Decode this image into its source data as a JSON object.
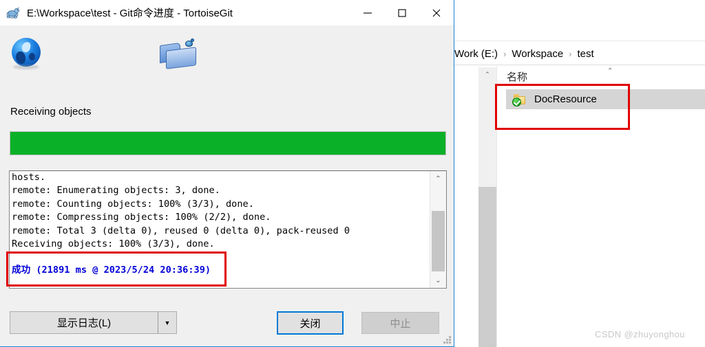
{
  "explorer": {
    "breadcrumb": {
      "items": [
        "Work (E:)",
        "Workspace",
        "test"
      ],
      "separator": "›"
    },
    "column_header": {
      "name_label": "名称",
      "sort_chevron": "⌃"
    },
    "items": [
      {
        "name": "DocResource",
        "icon": "folder-with-green-check-icon",
        "selected": true
      }
    ],
    "scrollbar": {
      "up_chevron": "⌃"
    }
  },
  "watermark": "CSDN @zhuyonghou",
  "dialog": {
    "title": "E:\\Workspace\\test - Git命令进度 - TortoiseGit",
    "icon": "tortoisegit-turtle-icon",
    "window_controls": {
      "minimize": "—",
      "maximize": "□",
      "close": "✕"
    },
    "status_label": "Receiving objects",
    "progress": {
      "percent": 100,
      "fill_color": "#0ab027"
    },
    "console": {
      "lines": "hosts.\nremote: Enumerating objects: 3, done.\nremote: Counting objects: 100% (3/3), done.\nremote: Compressing objects: 100% (2/2), done.\nremote: Total 3 (delta 0), reused 0 (delta 0), pack-reused 0\nReceiving objects: 100% (3/3), done.",
      "success_line": "成功 (21891 ms @ 2023/5/24 20:36:39)",
      "success_color": "#0000d8",
      "scrollbar": {
        "up_chevron": "⌃",
        "down_chevron": "⌄"
      }
    },
    "buttons": {
      "show_log": "显示日志(L)",
      "show_log_arrow": "▼",
      "close": "关闭",
      "abort": "中止",
      "abort_disabled": true
    }
  },
  "annotations": {
    "accent_color": "#e00000",
    "boxes": [
      "explorer-docresource-highlight",
      "console-success-highlight"
    ]
  }
}
